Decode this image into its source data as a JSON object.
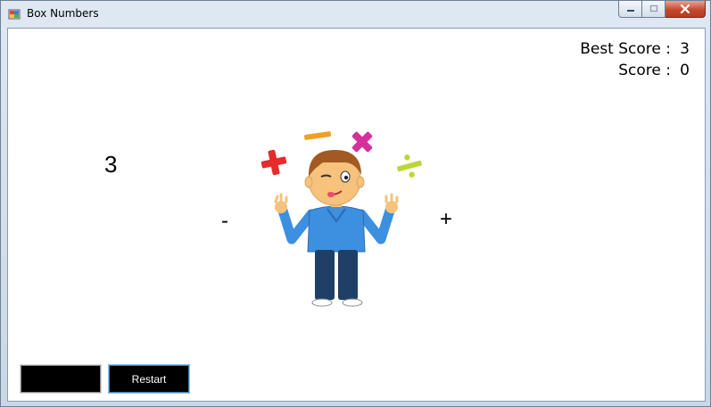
{
  "window": {
    "title": "Box Numbers",
    "app_icon": "winforms-app-icon",
    "controls": [
      "minimize-icon",
      "maximize-icon",
      "close-icon"
    ]
  },
  "scoreboard": {
    "best_label": "Best Score :",
    "best_value": "3",
    "score_label": "Score :",
    "score_value": "0"
  },
  "game": {
    "current_number": "3",
    "minus_operator": "-",
    "plus_operator": "+",
    "illustration": "boy-juggling-math-symbols"
  },
  "bottom_bar": {
    "answer_value": "",
    "restart_label": "Restart"
  },
  "colors": {
    "close_button": "#c44a2f",
    "restart_bg": "#000000",
    "restart_text": "#ffffff",
    "shirt": "#3d8fe0",
    "pants": "#1f3f66"
  }
}
